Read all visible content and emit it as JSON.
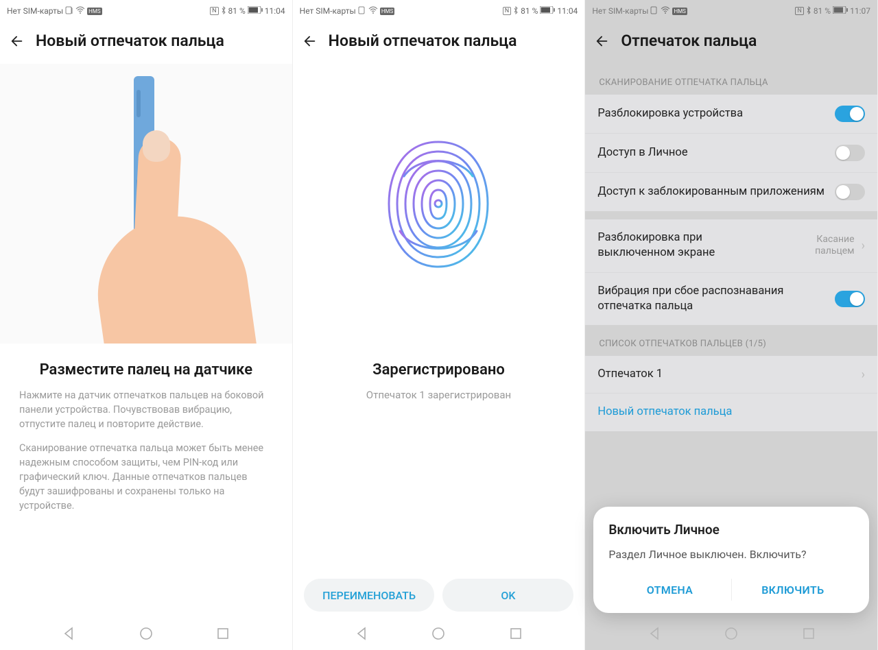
{
  "status": {
    "left": "Нет SIM-карты",
    "nfc": "N",
    "battery_pct": "81 %",
    "time_a": "11:04",
    "time_c": "11:07"
  },
  "screen1": {
    "title": "Новый отпечаток пальца",
    "instruction_title": "Разместите палец на датчике",
    "para1": "Нажмите на датчик отпечатков пальцев на боковой панели устройства. Почувствовав вибрацию, отпустите палец и повторите действие.",
    "para2": "Сканирование отпечатка пальца может быть менее надежным способом защиты, чем PIN-код или графический ключ. Данные отпечатков пальцев будут зашифрованы и сохранены только на устройстве."
  },
  "screen2": {
    "title": "Новый отпечаток пальца",
    "registered_title": "Зарегистрировано",
    "registered_sub": "Отпечаток 1 зарегистрирован",
    "rename_btn": "ПЕРЕИМЕНОВАТЬ",
    "ok_btn": "OK"
  },
  "screen3": {
    "title": "Отпечаток пальца",
    "section_scan": "СКАНИРОВАНИЕ ОТПЕЧАТКА ПАЛЬЦА",
    "row_unlock": "Разблокировка устройства",
    "row_private": "Доступ в Личное",
    "row_appslock": "Доступ к заблокированным приложениям",
    "row_screenoff": "Разблокировка при выключенном экране",
    "row_screenoff_val": "Касание пальцем",
    "row_vibe": "Вибрация при сбое распознавания отпечатка пальца",
    "section_list": "СПИСОК ОТПЕЧАТКОВ ПАЛЬЦЕВ (1/5)",
    "fp1": "Отпечаток 1",
    "new_fp": "Новый отпечаток пальца",
    "dialog_title": "Включить Личное",
    "dialog_body": "Раздел Личное выключен. Включить?",
    "dialog_cancel": "ОТМЕНА",
    "dialog_enable": "ВКЛЮЧИТЬ"
  }
}
